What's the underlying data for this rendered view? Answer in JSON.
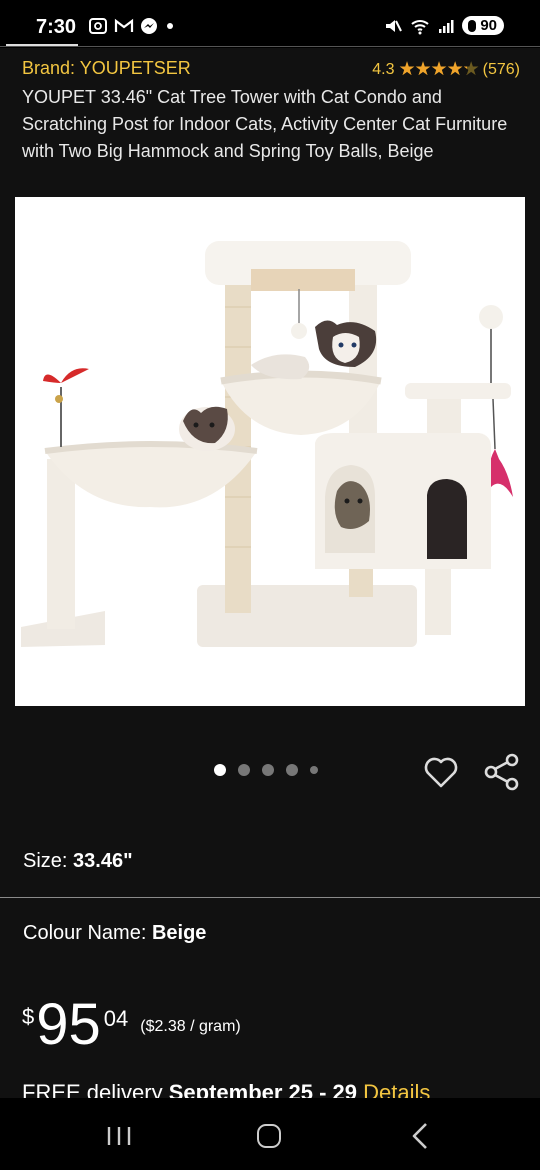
{
  "status_bar": {
    "time": "7:30",
    "left_icons": [
      "screenshot-icon",
      "gmail-icon",
      "messenger-icon",
      "dot-icon"
    ],
    "right_icons": [
      "mute-icon",
      "wifi-icon",
      "signal-icon"
    ],
    "battery": "90"
  },
  "product": {
    "brand": "Brand: YOUPETSER",
    "rating_value": "4.3",
    "rating_fraction": 0.86,
    "rating_count": "(576)",
    "title": "YOUPET 33.46\" Cat Tree Tower with Cat Condo and Scratching Post for Indoor Cats, Activity Center Cat Furniture with Two Big Hammock and Spring Toy Balls, Beige"
  },
  "gallery": {
    "image_count": 5,
    "active_index": 0
  },
  "options": {
    "size_label": "Size:",
    "size_value": "33.46\"",
    "colour_label": "Colour Name:",
    "colour_value": "Beige"
  },
  "price": {
    "currency": "$",
    "whole": "95",
    "fraction": "04",
    "unit_price": "($2.38 / gram)"
  },
  "delivery": {
    "prefix": "FREE delivery",
    "dates": "September 25 - 29",
    "link": "Details"
  },
  "colors": {
    "accent": "#f3c641",
    "star": "#f0a42b",
    "background": "#111111"
  }
}
